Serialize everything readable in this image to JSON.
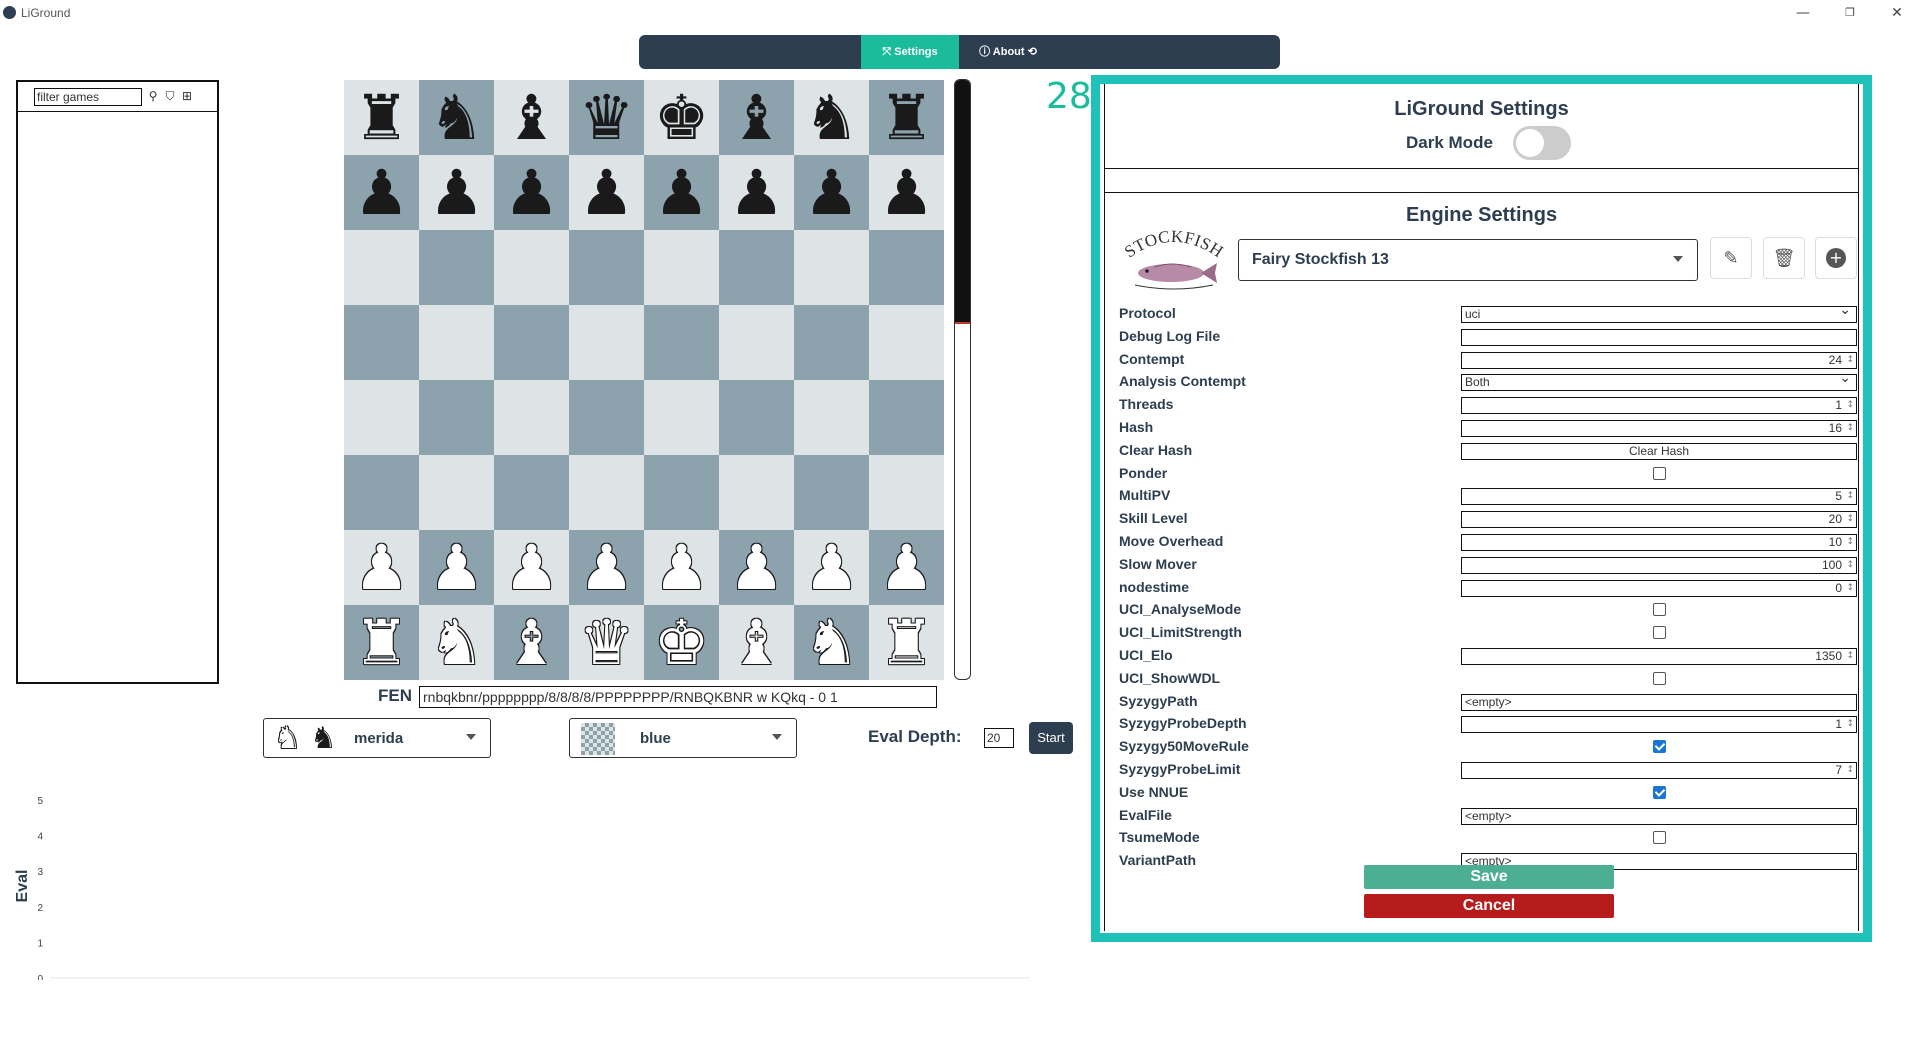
{
  "window": {
    "title": "LiGround",
    "min": "—",
    "max": "❐",
    "close": "✕"
  },
  "nav": {
    "settings": "⤧ Settings",
    "about": "ⓘ About ⟲"
  },
  "gamelist": {
    "filter_value": "filter games",
    "filter_placeholder": "filter games"
  },
  "board": {
    "rows": [
      [
        "r",
        "n",
        "b",
        "q",
        "k",
        "b",
        "n",
        "r"
      ],
      [
        "p",
        "p",
        "p",
        "p",
        "p",
        "p",
        "p",
        "p"
      ],
      [
        "",
        "",
        "",
        "",
        "",
        "",
        "",
        ""
      ],
      [
        "",
        "",
        "",
        "",
        "",
        "",
        "",
        ""
      ],
      [
        "",
        "",
        "",
        "",
        "",
        "",
        "",
        ""
      ],
      [
        "",
        "",
        "",
        "",
        "",
        "",
        "",
        ""
      ],
      [
        "P",
        "P",
        "P",
        "P",
        "P",
        "P",
        "P",
        "P"
      ],
      [
        "R",
        "N",
        "B",
        "Q",
        "K",
        "B",
        "N",
        "R"
      ]
    ],
    "light_color": "#dee3e6",
    "dark_color": "#8ca2ad"
  },
  "eval_bar": {
    "black_fraction": 0.405
  },
  "fen": {
    "label": "FEN",
    "value": "rnbqkbnr/pppppppp/8/8/8/8/PPPPPPPP/RNBQKBNR w KQkq - 0 1"
  },
  "piece_set": {
    "label": "merida"
  },
  "board_theme": {
    "label": "blue"
  },
  "eval_depth": {
    "label": "Eval Depth:",
    "value": "20"
  },
  "start_button": {
    "label": "Start"
  },
  "eval_chart": {
    "ylabel": "Eval",
    "ticks": [
      "5",
      "4",
      "3",
      "2",
      "1",
      "0"
    ]
  },
  "settings": {
    "panel_number": "28",
    "title": "LiGround Settings",
    "dark_mode_label": "Dark Mode",
    "dark_mode_on": false,
    "engine_title": "Engine Settings",
    "logo_text": "STOCKFISH",
    "engine_name": "Fairy Stockfish 13",
    "save": "Save",
    "cancel": "Cancel",
    "options": [
      {
        "label": "Protocol",
        "type": "select",
        "value": "uci"
      },
      {
        "label": "Debug Log File",
        "type": "text",
        "value": ""
      },
      {
        "label": "Contempt",
        "type": "number",
        "value": "24"
      },
      {
        "label": "Analysis Contempt",
        "type": "select",
        "value": "Both"
      },
      {
        "label": "Threads",
        "type": "number",
        "value": "1"
      },
      {
        "label": "Hash",
        "type": "number",
        "value": "16"
      },
      {
        "label": "Clear Hash",
        "type": "button",
        "value": "Clear Hash"
      },
      {
        "label": "Ponder",
        "type": "check",
        "value": false
      },
      {
        "label": "MultiPV",
        "type": "number",
        "value": "5"
      },
      {
        "label": "Skill Level",
        "type": "number",
        "value": "20"
      },
      {
        "label": "Move Overhead",
        "type": "number",
        "value": "10"
      },
      {
        "label": "Slow Mover",
        "type": "number",
        "value": "100"
      },
      {
        "label": "nodestime",
        "type": "number",
        "value": "0"
      },
      {
        "label": "UCI_AnalyseMode",
        "type": "check",
        "value": false
      },
      {
        "label": "UCI_LimitStrength",
        "type": "check",
        "value": false
      },
      {
        "label": "UCI_Elo",
        "type": "number",
        "value": "1350"
      },
      {
        "label": "UCI_ShowWDL",
        "type": "check",
        "value": false
      },
      {
        "label": "SyzygyPath",
        "type": "text",
        "value": "<empty>"
      },
      {
        "label": "SyzygyProbeDepth",
        "type": "number",
        "value": "1"
      },
      {
        "label": "Syzygy50MoveRule",
        "type": "check",
        "value": true
      },
      {
        "label": "SyzygyProbeLimit",
        "type": "number",
        "value": "7"
      },
      {
        "label": "Use NNUE",
        "type": "check",
        "value": true
      },
      {
        "label": "EvalFile",
        "type": "text",
        "value": "<empty>"
      },
      {
        "label": "TsumeMode",
        "type": "check",
        "value": false
      },
      {
        "label": "VariantPath",
        "type": "text",
        "value": "<empty>"
      }
    ]
  }
}
